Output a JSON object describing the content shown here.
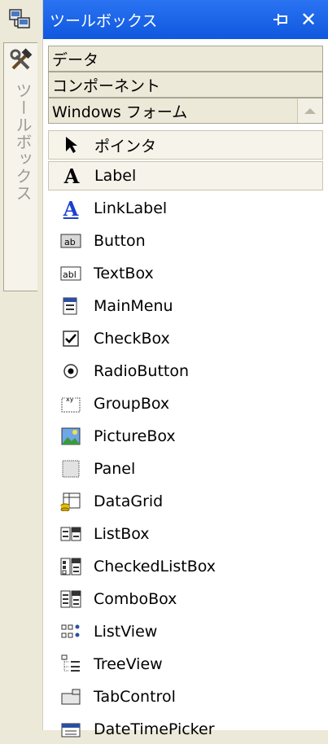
{
  "strip": {
    "vertical_label": "ツールボックス"
  },
  "panel": {
    "title": "ツールボックス",
    "close_symbol": "✕",
    "categories": [
      {
        "label": "データ"
      },
      {
        "label": "コンポーネント"
      },
      {
        "label": "Windows フォーム"
      }
    ],
    "items": [
      {
        "label": "ポインタ",
        "icon": "pointer-arrow-icon"
      },
      {
        "label": "Label",
        "icon": "label-a-icon"
      },
      {
        "label": "LinkLabel",
        "icon": "linklabel-a-icon"
      },
      {
        "label": "Button",
        "icon": "button-icon"
      },
      {
        "label": "TextBox",
        "icon": "textbox-icon"
      },
      {
        "label": "MainMenu",
        "icon": "mainmenu-icon"
      },
      {
        "label": "CheckBox",
        "icon": "checkbox-icon"
      },
      {
        "label": "RadioButton",
        "icon": "radiobutton-icon"
      },
      {
        "label": "GroupBox",
        "icon": "groupbox-icon"
      },
      {
        "label": "PictureBox",
        "icon": "picturebox-icon"
      },
      {
        "label": "Panel",
        "icon": "panel-icon"
      },
      {
        "label": "DataGrid",
        "icon": "datagrid-icon"
      },
      {
        "label": "ListBox",
        "icon": "listbox-icon"
      },
      {
        "label": "CheckedListBox",
        "icon": "checkedlistbox-icon"
      },
      {
        "label": "ComboBox",
        "icon": "combobox-icon"
      },
      {
        "label": "ListView",
        "icon": "listview-icon"
      },
      {
        "label": "TreeView",
        "icon": "treeview-icon"
      },
      {
        "label": "TabControl",
        "icon": "tabcontrol-icon"
      },
      {
        "label": "DateTimePicker",
        "icon": "datetimepicker-icon"
      }
    ]
  },
  "colors": {
    "title_bar": "#1a63e8",
    "panel_bg": "#ffffff",
    "chrome_bg": "#ece9d8",
    "link_blue": "#0000ff"
  }
}
